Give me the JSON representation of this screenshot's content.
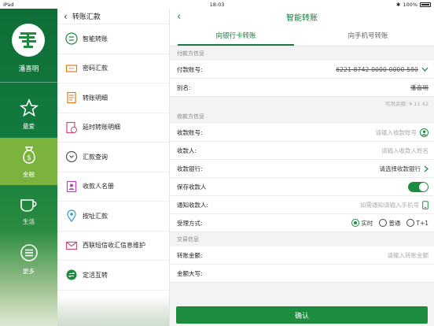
{
  "status_bar": {
    "carrier": "iPad",
    "time": "18:03",
    "battery": "100%"
  },
  "rail": {
    "user_name": "潘喜明",
    "items": [
      {
        "label": "最爱",
        "icon": "star-icon"
      },
      {
        "label": "金融",
        "icon": "money-bag-icon"
      },
      {
        "label": "生活",
        "icon": "coffee-cup-icon"
      },
      {
        "label": "更多",
        "icon": "menu-icon"
      }
    ],
    "active_index": 1
  },
  "submenu": {
    "title": "转账汇款",
    "items": [
      {
        "label": "智能转账",
        "icon": "smart-transfer-icon"
      },
      {
        "label": "密码汇款",
        "icon": "password-remit-icon"
      },
      {
        "label": "转账明细",
        "icon": "transfer-detail-icon"
      },
      {
        "label": "延时转账明细",
        "icon": "delay-transfer-icon"
      },
      {
        "label": "汇款查询",
        "icon": "remit-query-icon"
      },
      {
        "label": "收款人名册",
        "icon": "payee-book-icon"
      },
      {
        "label": "按址汇款",
        "icon": "address-remit-icon"
      },
      {
        "label": "西联短信收汇信息维护",
        "icon": "sms-icon"
      },
      {
        "label": "定活互转",
        "icon": "exchange-icon"
      }
    ]
  },
  "main": {
    "title": "智能转账",
    "tabs": [
      "向银行卡转账",
      "向手机号转账"
    ],
    "active_tab": 0,
    "payer": {
      "section": "付款方信息",
      "account_label": "付款账号:",
      "account_value": "6221 8742 0000 0000 580",
      "alias_label": "别名:",
      "alias_value": "潘喜明",
      "balance": "可用余额: ¥ 11.42"
    },
    "payee": {
      "section": "收款方信息",
      "account_label": "收款账号:",
      "account_placeholder": "请输入收款账号",
      "name_label": "收款人:",
      "name_placeholder": "请输入收款人姓名",
      "bank_label": "收款银行:",
      "bank_placeholder": "请选择收款银行",
      "save_label": "保存收款人",
      "notify_label": "通知收款人:",
      "notify_placeholder": "如需通知请输入手机号",
      "mode_label": "受理方式:",
      "modes": [
        "实时",
        "普通",
        "T+1"
      ],
      "selected_mode": 0
    },
    "trade": {
      "section": "交易信息",
      "amount_label": "转账金额:",
      "amount_placeholder": "请输入转账金额",
      "amount_words_label": "金额大写:"
    },
    "confirm_label": "确认"
  },
  "colors": {
    "brand_green": "#1e8c3f",
    "rail_active": "#7bb33e",
    "accent_text": "#1a7a40"
  }
}
